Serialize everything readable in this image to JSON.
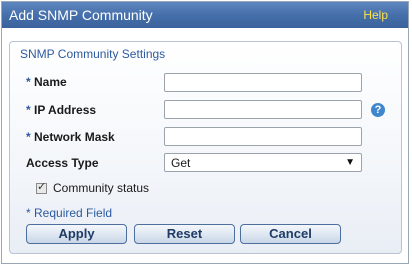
{
  "dialog": {
    "title": "Add SNMP Community",
    "help_label": "Help"
  },
  "panel": {
    "title": "SNMP Community Settings",
    "required_marker": "*"
  },
  "fields": {
    "name": {
      "label": "Name",
      "value": ""
    },
    "ip_address": {
      "label": "IP Address",
      "value": ""
    },
    "network_mask": {
      "label": "Network Mask",
      "value": ""
    },
    "access_type": {
      "label": "Access Type",
      "value": "Get"
    }
  },
  "community_status": {
    "label": "Community status",
    "checked": true
  },
  "required_note": "* Required Field",
  "buttons": {
    "apply": "Apply",
    "reset": "Reset",
    "cancel": "Cancel"
  },
  "icons": {
    "help": "question-circle-icon",
    "dropdown": "caret-down-icon",
    "check": "checkmark-icon"
  },
  "colors": {
    "titlebar": "#446ea9",
    "help_link": "#ffe24a",
    "accent": "#2c5aa0",
    "help_icon": "#3f86cc"
  }
}
